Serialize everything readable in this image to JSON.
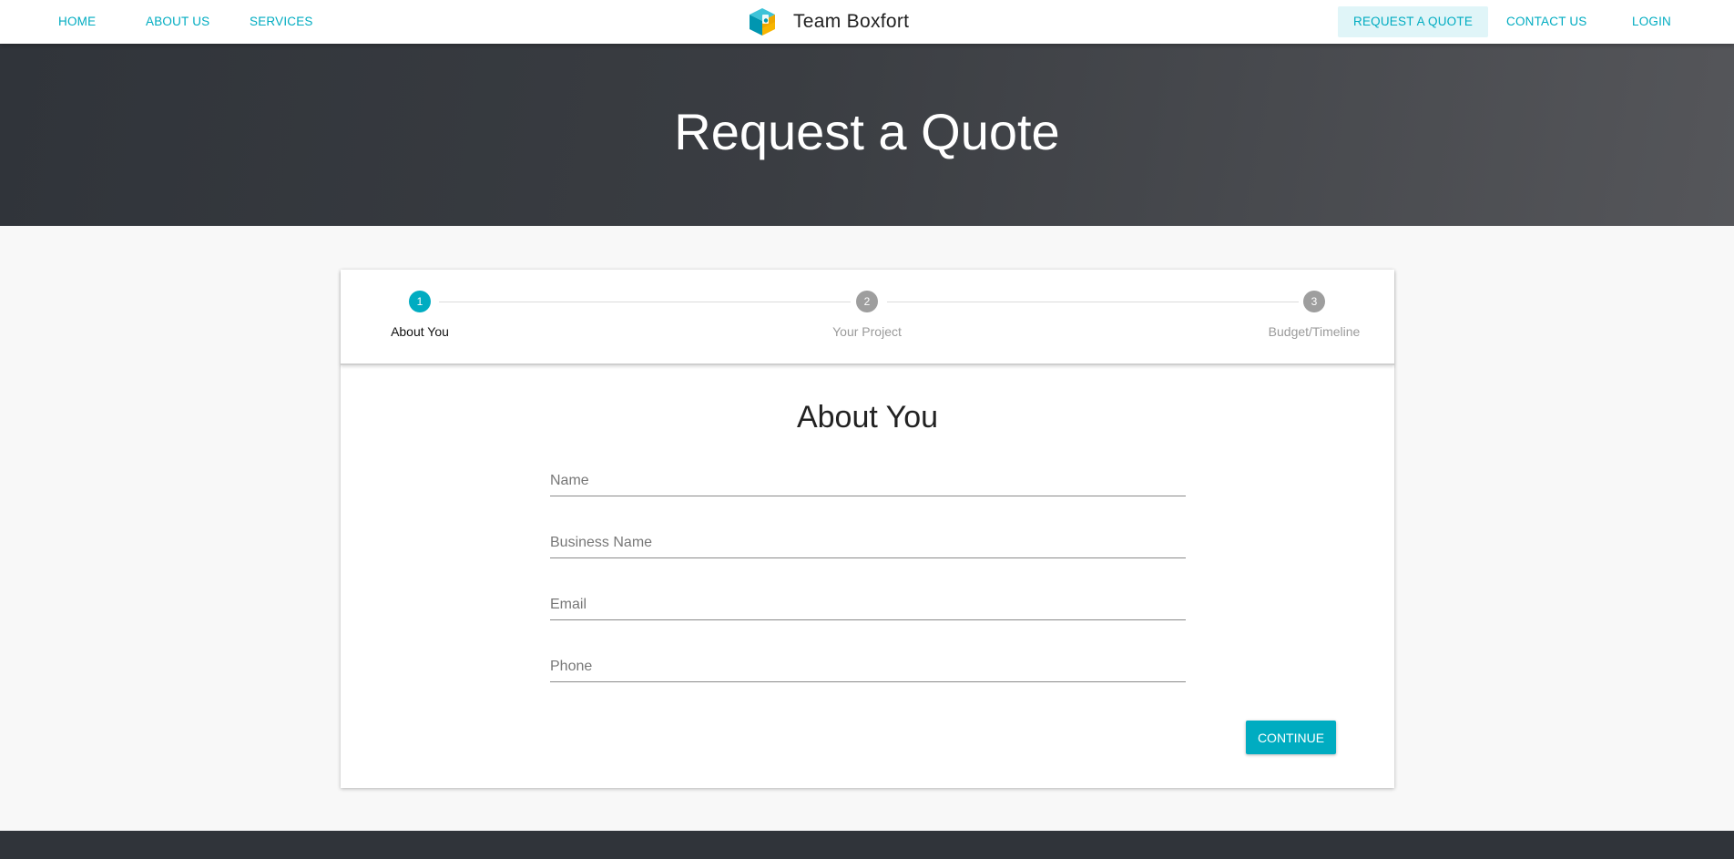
{
  "nav": {
    "left": [
      {
        "label": "HOME"
      },
      {
        "label": "ABOUT US"
      },
      {
        "label": "SERVICES"
      }
    ],
    "brand": {
      "name": "Team Boxfort",
      "logo_icon": "boxfort-cube-icon"
    },
    "right": [
      {
        "label": "REQUEST A QUOTE",
        "active": true
      },
      {
        "label": "CONTACT US"
      },
      {
        "label": "LOGIN"
      }
    ]
  },
  "hero": {
    "title": "Request a Quote"
  },
  "stepper": {
    "steps": [
      {
        "number": "1",
        "label": "About You",
        "state": "active"
      },
      {
        "number": "2",
        "label": "Your Project",
        "state": "inactive"
      },
      {
        "number": "3",
        "label": "Budget/Timeline",
        "state": "inactive"
      }
    ]
  },
  "form": {
    "title": "About You",
    "fields": [
      {
        "placeholder": "Name",
        "value": ""
      },
      {
        "placeholder": "Business Name",
        "value": ""
      },
      {
        "placeholder": "Email",
        "value": ""
      },
      {
        "placeholder": "Phone",
        "value": ""
      }
    ],
    "continue_label": "CONTINUE"
  },
  "colors": {
    "accent": "#00acc1",
    "hero_dark": "#30343a",
    "step_inactive": "#9e9e9e"
  }
}
